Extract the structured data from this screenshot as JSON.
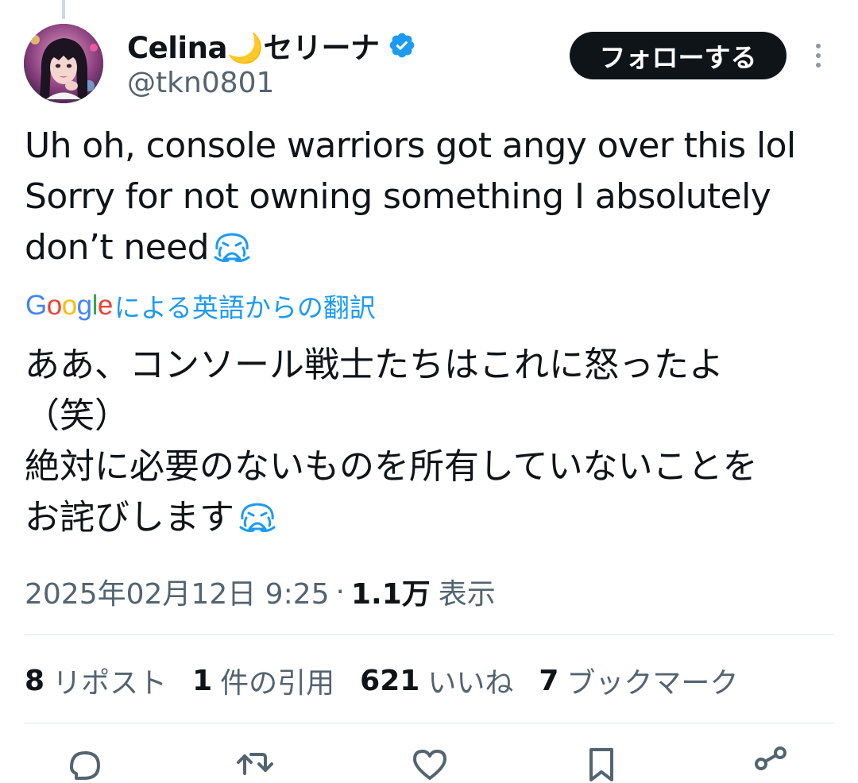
{
  "user": {
    "display_name": "Celina🌙セリーナ",
    "handle": "@tkn0801",
    "verified_icon": "verified-badge-icon",
    "avatar_icon": "avatar"
  },
  "header": {
    "follow_label": "フォローする",
    "more_icon": "more-vertical-icon"
  },
  "tweet": {
    "lines": [
      "Uh oh, console warriors got angy over this lol",
      "Sorry for not owning something I absolutely",
      "don’t need"
    ],
    "emoji_icon": "crying-face-emoji-icon"
  },
  "translation": {
    "google": [
      "G",
      "o",
      "o",
      "g",
      "l",
      "e"
    ],
    "label": "による英語からの翻訳",
    "lines": [
      "ああ、コンソール戦士たちはこれに怒ったよ",
      "（笑）",
      "絶対に必要のないものを所有していないことを",
      "お詫びします"
    ]
  },
  "meta": {
    "timestamp": "2025年02月12日 9:25",
    "separator": "·",
    "views_count": "1.1万",
    "views_label": "表示"
  },
  "stats": [
    {
      "count": "8",
      "label": "リポスト"
    },
    {
      "count": "1",
      "label": "件の引用"
    },
    {
      "count": "621",
      "label": "いいね"
    },
    {
      "count": "7",
      "label": "ブックマーク"
    }
  ],
  "actions": [
    {
      "icon": "reply-icon"
    },
    {
      "icon": "repost-icon"
    },
    {
      "icon": "like-icon"
    },
    {
      "icon": "bookmark-icon"
    },
    {
      "icon": "share-icon"
    }
  ],
  "colors": {
    "accent": "#1d9bf0",
    "text": "#0f1419",
    "secondary": "#536471",
    "google_blue": "#4285f4",
    "google_red": "#ea4335",
    "google_yellow": "#fbbc05",
    "google_green": "#34a853"
  }
}
